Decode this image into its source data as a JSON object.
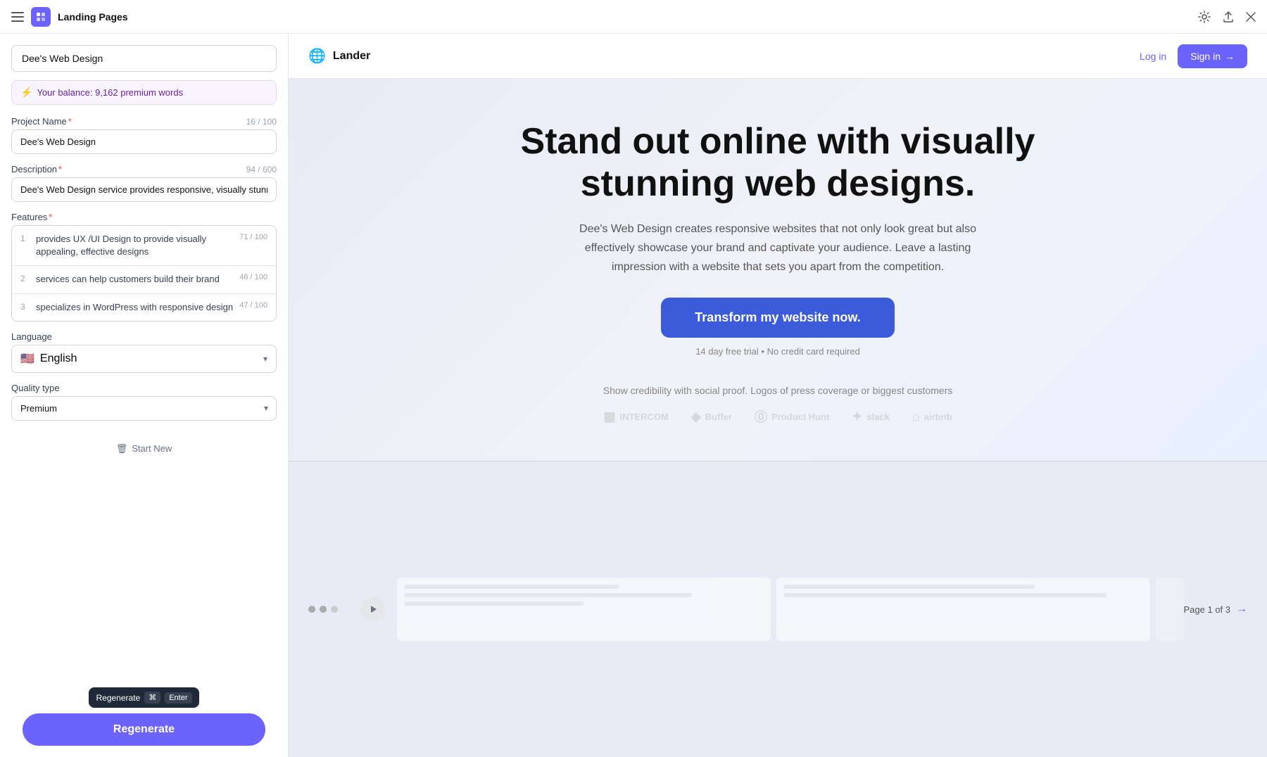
{
  "titleBar": {
    "title": "Landing Pages",
    "icon": "📄"
  },
  "leftPanel": {
    "projectNameDisplay": "Dee's Web Design",
    "balance": {
      "icon": "⚡",
      "text": "Your balance: 9,162 premium words"
    },
    "projectNameField": {
      "label": "Project Name",
      "required": true,
      "counter": "16 / 100",
      "value": "Dee's Web Design"
    },
    "descriptionField": {
      "label": "Description",
      "required": true,
      "counter": "94 / 600",
      "value": "Dee's Web Design service provides responsive, visually stunning de"
    },
    "featuresField": {
      "label": "Features",
      "required": true,
      "items": [
        {
          "num": 1,
          "text": "provides UX /UI Design to provide visually appealing, effective designs",
          "counter": "71 / 100"
        },
        {
          "num": 2,
          "text": "services can help customers build their brand",
          "counter": "46 / 100"
        },
        {
          "num": 3,
          "text": "specializes in WordPress with responsive design",
          "counter": "47 / 100"
        }
      ]
    },
    "languageField": {
      "label": "Language",
      "flag": "🇺🇸",
      "value": "English"
    },
    "qualityField": {
      "label": "Quality type",
      "value": "Premium"
    },
    "startNewLabel": "Start New",
    "tooltip": {
      "label": "Regenerate",
      "kbd1": "⌘",
      "kbd2": "Enter"
    },
    "regenerateBtn": "Regenerate"
  },
  "preview": {
    "brand": {
      "globe": "🌐",
      "name": "Lander"
    },
    "nav": {
      "loginLabel": "Log in",
      "signupLabel": "Sign in",
      "signupArrow": "→"
    },
    "hero": {
      "title": "Stand out online with visually stunning web designs.",
      "subtitle": "Dee's Web Design creates responsive websites that not only look great but also effectively showcase your brand and captivate your audience. Leave a lasting impression with a website that sets you apart from the competition.",
      "ctaLabel": "Transform my website now.",
      "trialText": "14 day free trial • No credit card required"
    },
    "socialProof": {
      "text": "Show credibility with social proof. Logos of press coverage or biggest customers",
      "logos": [
        {
          "icon": "▦",
          "name": "INTERCOM"
        },
        {
          "icon": "◈",
          "name": "Buffer"
        },
        {
          "icon": "Ⓟ",
          "name": "Product Hunt"
        },
        {
          "icon": "✦",
          "name": "slack"
        },
        {
          "icon": "⌂",
          "name": "airbnb"
        }
      ]
    },
    "pagination": {
      "label": "Page 1 of 3",
      "arrow": "→"
    }
  }
}
